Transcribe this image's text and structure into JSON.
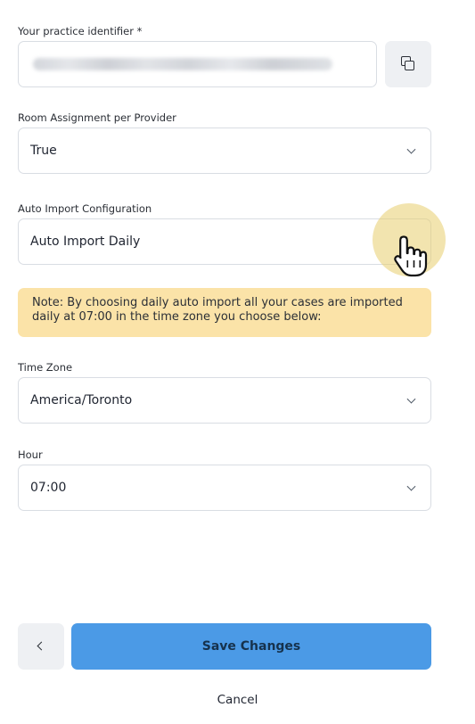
{
  "practice_identifier": {
    "label": "Your practice identifier *",
    "value_hidden": true
  },
  "room_assignment": {
    "label": "Room Assignment per Provider",
    "value": "True"
  },
  "auto_import": {
    "label": "Auto Import Configuration",
    "value": "Auto Import Daily"
  },
  "note": {
    "text": "Note: By choosing daily auto import all your cases are imported daily at 07:00 in the time zone you choose below:"
  },
  "time_zone": {
    "label": "Time Zone",
    "value": "America/Toronto"
  },
  "hour": {
    "label": "Hour",
    "value": "07:00"
  },
  "actions": {
    "save_label": "Save Changes",
    "cancel_label": "Cancel"
  },
  "colors": {
    "primary": "#4b9ae6",
    "note_bg": "#fbe3a8",
    "cursor_halo": "#e8ce6e"
  },
  "icons": {
    "copy": "copy-icon",
    "chevron": "chevron-down-icon",
    "back": "chevron-left-icon",
    "cursor": "hand-pointer-icon"
  }
}
